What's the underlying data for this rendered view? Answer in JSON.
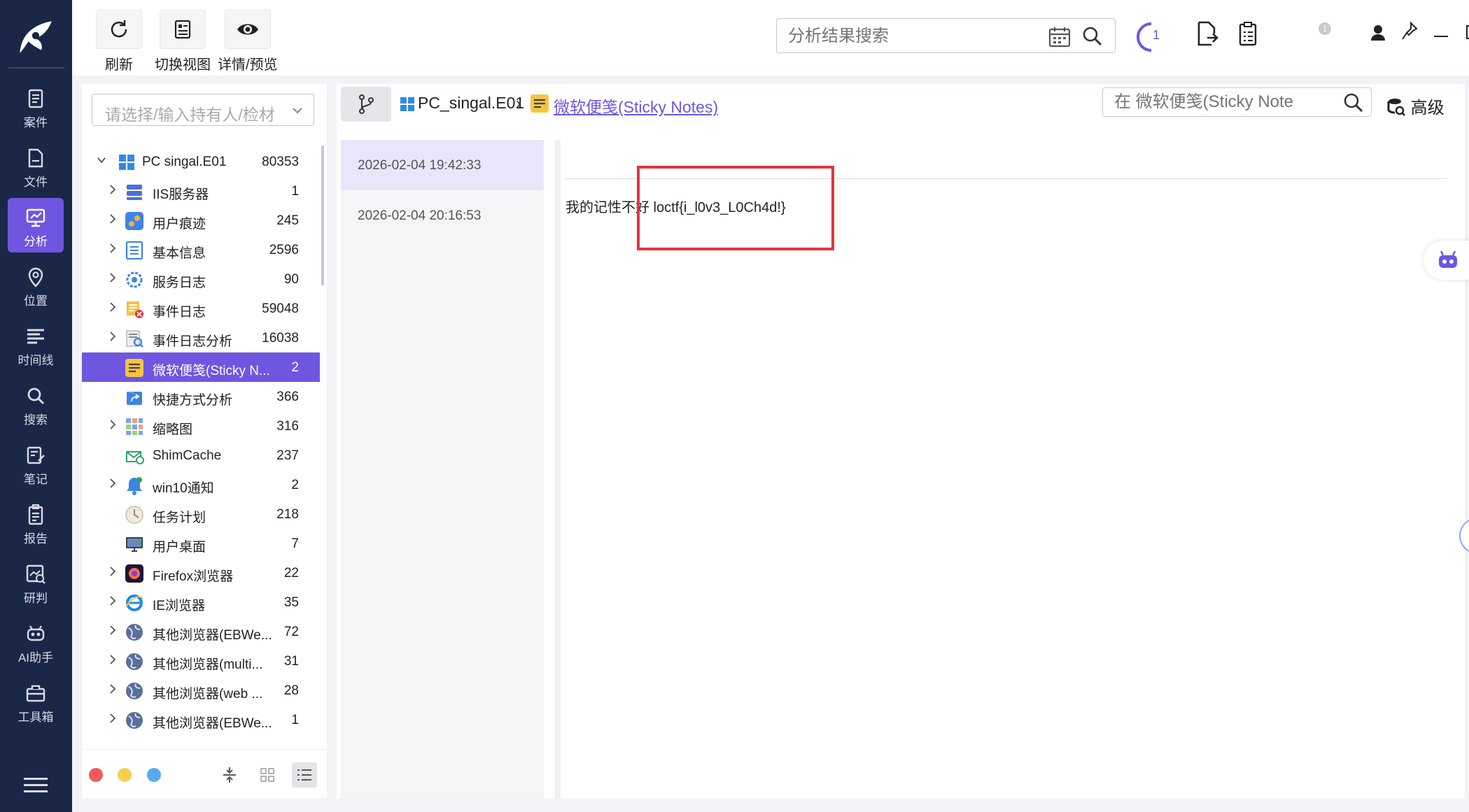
{
  "toolbar": {
    "refresh": "刷新",
    "switch_view": "切换视图",
    "detail_preview": "详情/预览",
    "search_placeholder": "分析结果搜索",
    "task_count": "1",
    "notification_badge": "1"
  },
  "nav": [
    {
      "label": "案件",
      "icon": "case-icon"
    },
    {
      "label": "文件",
      "icon": "file-icon"
    },
    {
      "label": "分析",
      "icon": "analysis-icon",
      "active": true
    },
    {
      "label": "位置",
      "icon": "location-icon"
    },
    {
      "label": "时间线",
      "icon": "timeline-icon"
    },
    {
      "label": "搜索",
      "icon": "search-icon"
    },
    {
      "label": "笔记",
      "icon": "notes-icon"
    },
    {
      "label": "报告",
      "icon": "report-icon"
    },
    {
      "label": "研判",
      "icon": "judge-icon"
    },
    {
      "label": "AI助手",
      "icon": "ai-assistant-icon"
    },
    {
      "label": "工具箱",
      "icon": "toolbox-icon"
    }
  ],
  "tree": {
    "owner_placeholder": "请选择/输入持有人/检材",
    "root": {
      "label": "PC singal.E01",
      "count": "80353"
    },
    "items": [
      {
        "label": "IIS服务器",
        "count": "1",
        "icon": "server-icon",
        "expandable": true
      },
      {
        "label": "用户痕迹",
        "count": "245",
        "icon": "footprint-icon",
        "expandable": true
      },
      {
        "label": "基本信息",
        "count": "2596",
        "icon": "info-list-icon",
        "expandable": true
      },
      {
        "label": "服务日志",
        "count": "90",
        "icon": "service-gear-icon",
        "expandable": true
      },
      {
        "label": "事件日志",
        "count": "59048",
        "icon": "event-log-icon",
        "expandable": true
      },
      {
        "label": "事件日志分析",
        "count": "16038",
        "icon": "log-analysis-icon",
        "expandable": true
      },
      {
        "label": "微软便笺(Sticky N...",
        "count": "2",
        "icon": "sticky-note-icon",
        "expandable": false,
        "selected": true
      },
      {
        "label": "快捷方式分析",
        "count": "366",
        "icon": "shortcut-icon",
        "expandable": false
      },
      {
        "label": "缩略图",
        "count": "316",
        "icon": "thumbnail-icon",
        "expandable": true
      },
      {
        "label": "ShimCache",
        "count": "237",
        "icon": "shimcache-icon",
        "expandable": false
      },
      {
        "label": "win10通知",
        "count": "2",
        "icon": "bell-icon",
        "expandable": true
      },
      {
        "label": "任务计划",
        "count": "218",
        "icon": "clock-icon",
        "expandable": false
      },
      {
        "label": "用户桌面",
        "count": "7",
        "icon": "desktop-icon",
        "expandable": false
      },
      {
        "label": "Firefox浏览器",
        "count": "22",
        "icon": "firefox-icon",
        "expandable": true
      },
      {
        "label": "IE浏览器",
        "count": "35",
        "icon": "ie-icon",
        "expandable": true
      },
      {
        "label": "其他浏览器(EBWe...",
        "count": "72",
        "icon": "globe-icon",
        "expandable": true
      },
      {
        "label": "其他浏览器(multi...",
        "count": "31",
        "icon": "globe-icon",
        "expandable": true
      },
      {
        "label": "其他浏览器(web ...",
        "count": "28",
        "icon": "globe-icon",
        "expandable": true
      },
      {
        "label": "其他浏览器(EBWe...",
        "count": "1",
        "icon": "globe-icon",
        "expandable": true
      }
    ]
  },
  "breadcrumb": {
    "source": "PC_singal.E01",
    "current": "微软便笺(Sticky Notes)"
  },
  "content_search_placeholder": "在 微软便笺(Sticky Note",
  "advanced_label": "高级",
  "notes": [
    {
      "time": "2026-02-04 19:42:33",
      "active": true
    },
    {
      "time": "2026-02-04 20:16:53",
      "active": false
    }
  ],
  "detail_text": "我的记性不好 loctf{i_l0v3_L0Ch4d!}",
  "colors": {
    "accent": "#6f56e0",
    "rail_bg": "#1b2746",
    "highlight_box": "#e5333f",
    "dot_red": "#ef5a5a",
    "dot_yellow": "#f5d050",
    "dot_blue": "#5aa9ef"
  }
}
